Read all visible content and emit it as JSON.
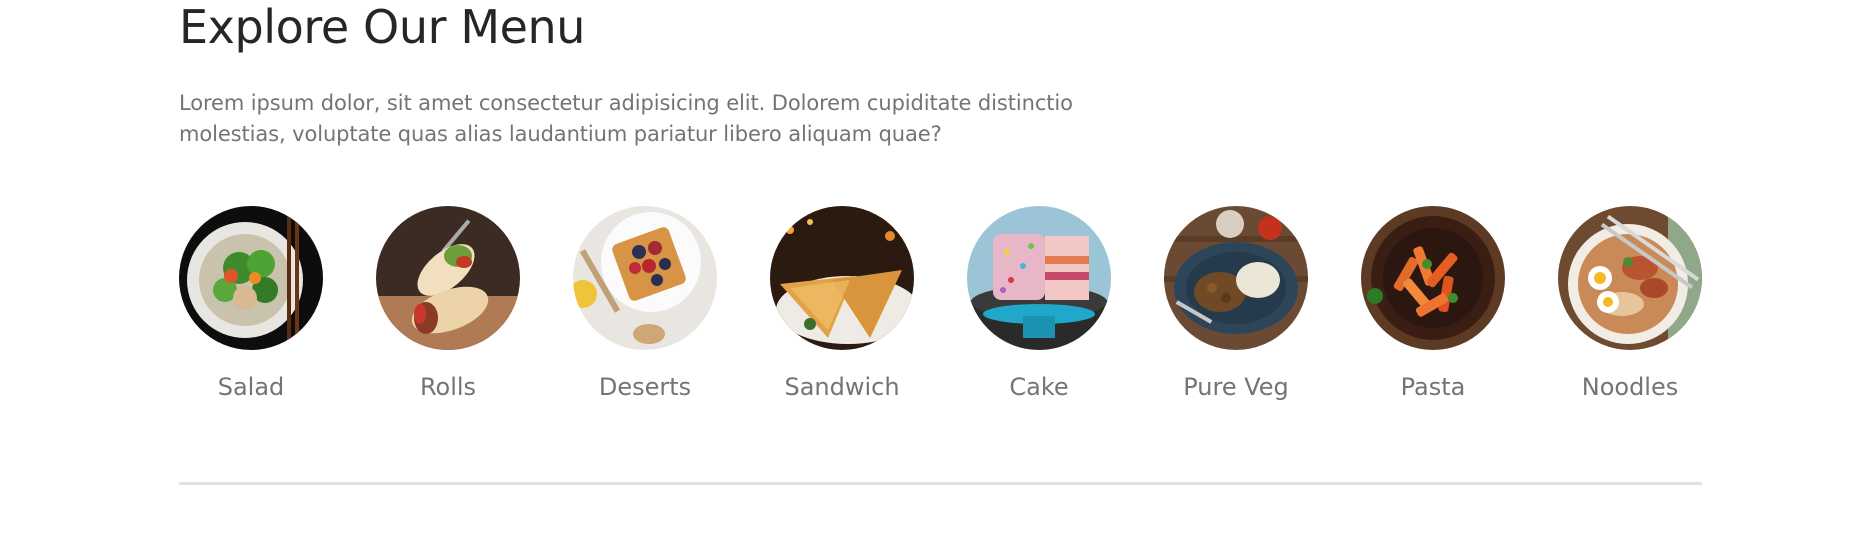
{
  "explore": {
    "title": "Explore Our Menu",
    "description": "Lorem ipsum dolor, sit amet consectetur adipisicing elit. Dolorem cupiditate distinctio molestias, voluptate quas alias laudantium pariatur libero aliquam quae?"
  },
  "menu": {
    "items": [
      {
        "label": "Salad",
        "icon": "salad-image"
      },
      {
        "label": "Rolls",
        "icon": "rolls-image"
      },
      {
        "label": "Deserts",
        "icon": "deserts-image"
      },
      {
        "label": "Sandwich",
        "icon": "sandwich-image"
      },
      {
        "label": "Cake",
        "icon": "cake-image"
      },
      {
        "label": "Pure Veg",
        "icon": "pure-veg-image"
      },
      {
        "label": "Pasta",
        "icon": "pasta-image"
      },
      {
        "label": "Noodles",
        "icon": "noodles-image"
      }
    ]
  },
  "colors": {
    "heading": "#262626",
    "body_text": "#747474",
    "divider": "#e2e2e2"
  }
}
